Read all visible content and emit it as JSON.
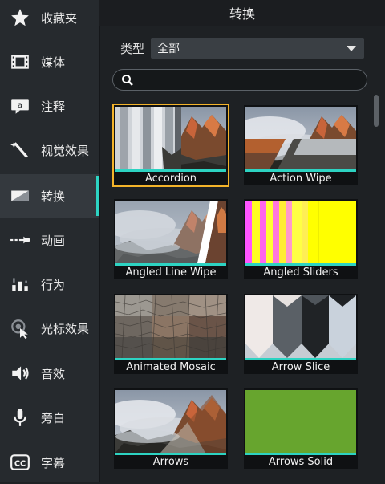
{
  "sidebar": {
    "items": [
      {
        "label": "收藏夹",
        "icon": "star-icon"
      },
      {
        "label": "媒体",
        "icon": "film-icon"
      },
      {
        "label": "注释",
        "icon": "annotation-icon"
      },
      {
        "label": "视觉效果",
        "icon": "magic-wand-icon"
      },
      {
        "label": "转换",
        "icon": "transition-icon",
        "active": true
      },
      {
        "label": "动画",
        "icon": "animation-arrow-icon"
      },
      {
        "label": "行为",
        "icon": "behavior-icon"
      },
      {
        "label": "光标效果",
        "icon": "cursor-effect-icon"
      },
      {
        "label": "音效",
        "icon": "speaker-icon"
      },
      {
        "label": "旁白",
        "icon": "microphone-icon"
      },
      {
        "label": "字幕",
        "icon": "captions-icon"
      }
    ]
  },
  "panel": {
    "title": "转换",
    "type_label": "类型",
    "type_value": "全部",
    "search_placeholder": ""
  },
  "transitions": [
    {
      "label": "Accordion",
      "selected": true
    },
    {
      "label": "Action Wipe"
    },
    {
      "label": "Angled Line Wipe"
    },
    {
      "label": "Angled Sliders"
    },
    {
      "label": "Animated Mosaic"
    },
    {
      "label": "Arrow Slice"
    },
    {
      "label": "Arrows"
    },
    {
      "label": "Arrows Solid"
    }
  ],
  "colors": {
    "accent_teal": "#2dd3c2",
    "selection": "#f3b32a",
    "sidebar_bg": "#262a2e",
    "panel_bg": "#1e2124"
  }
}
